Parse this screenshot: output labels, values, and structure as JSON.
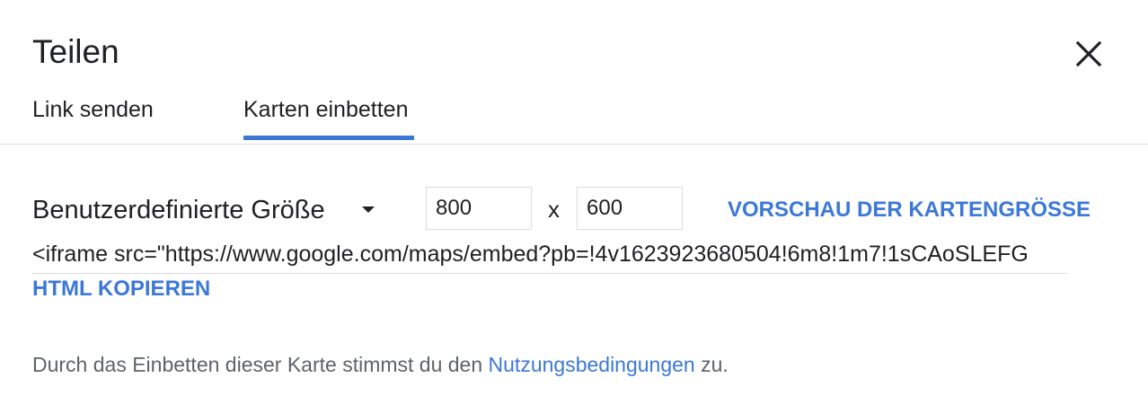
{
  "dialog": {
    "title": "Teilen",
    "close_icon": "close-icon"
  },
  "tabs": [
    {
      "label": "Link senden",
      "active": false
    },
    {
      "label": "Karten einbetten",
      "active": true
    }
  ],
  "colors": {
    "accent": "#3b78d8",
    "text": "#202124",
    "secondary_text": "#5f6368",
    "divider": "#dadce0"
  },
  "size": {
    "selected": "Benutzerdefinierte Größe",
    "dropdown_icon": "caret-down-icon",
    "width": "800",
    "separator": "x",
    "height": "600",
    "preview_label": "VORSCHAU DER KARTENGRÖSSE"
  },
  "embed": {
    "code": "<iframe src=\"https://www.google.com/maps/embed?pb=!4v1623923680504!6m8!1m7!1sCAoSLEFG",
    "copy_label": "HTML KOPIEREN"
  },
  "terms": {
    "prefix": "Durch das Einbetten dieser Karte stimmst du den ",
    "link": "Nutzungsbedingungen",
    "suffix": " zu."
  }
}
